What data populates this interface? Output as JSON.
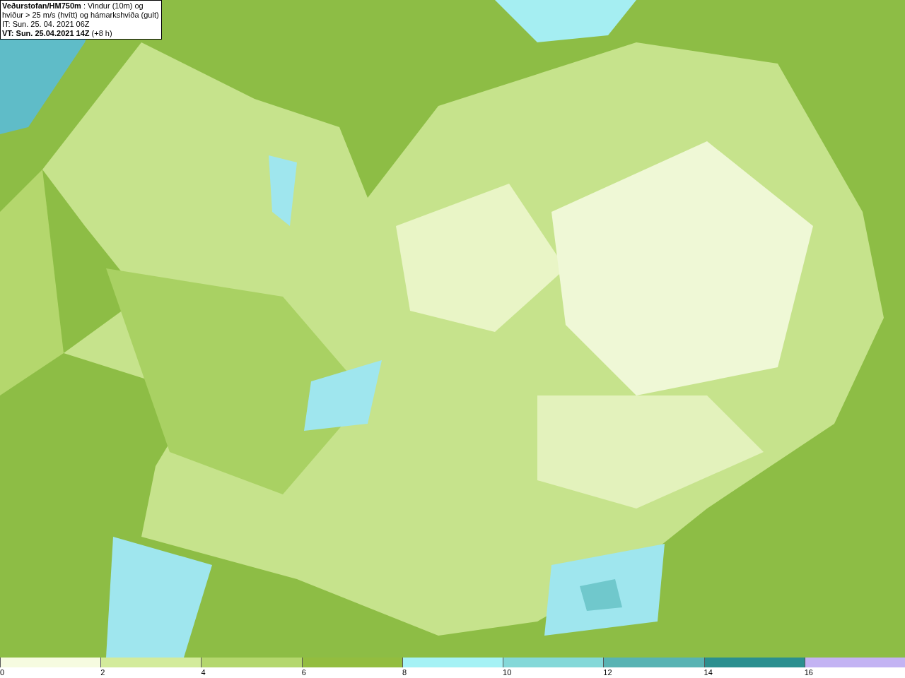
{
  "header": {
    "lines": [
      "**Veðurstofan/HM750m** : Vindur (10m) og",
      "hviður > 25 m/s (hvítt) og hámarkshviða (gult)",
      "IT: Sun. 25. 04. 2021 06Z",
      "**VT: Sun. 25.04.2021 14Z** (+8 h)"
    ]
  },
  "legend": {
    "segments": [
      {
        "label": "0",
        "color": "#f6fbe0"
      },
      {
        "label": "2",
        "color": "#d3eb9b"
      },
      {
        "label": "4",
        "color": "#b4d76d"
      },
      {
        "label": "6",
        "color": "#93bd3f"
      },
      {
        "label": "8",
        "color": "#a5f2f5"
      },
      {
        "label": "10",
        "color": "#84d8d8"
      },
      {
        "label": "12",
        "color": "#58b3b3"
      },
      {
        "label": "14",
        "color": "#2b8f8f"
      },
      {
        "label": "16",
        "color": "#c3b3f3"
      }
    ]
  }
}
